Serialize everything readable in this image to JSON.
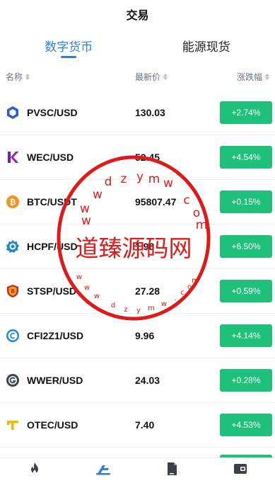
{
  "header": {
    "title": "交易"
  },
  "tabs": [
    {
      "label": "数字货币",
      "active": true
    },
    {
      "label": "能源现货",
      "active": false
    }
  ],
  "columns": {
    "name": "名称",
    "price": "最新价",
    "change": "涨跌幅"
  },
  "rows": [
    {
      "symbol": "PVSC/USD",
      "price": "130.03",
      "change": "+2.74%",
      "icon": "pvsc-hexagon-icon"
    },
    {
      "symbol": "WEC/USD",
      "price": "52.45",
      "change": "+4.54%",
      "icon": "wec-k-logo-icon"
    },
    {
      "symbol": "BTC/USDT",
      "price": "95807.47",
      "change": "+0.15%",
      "icon": "bitcoin-icon"
    },
    {
      "symbol": "HCPF/USD",
      "price": "1.98",
      "change": "+6.50%",
      "icon": "hcpf-badge-icon"
    },
    {
      "symbol": "STSP/USD",
      "price": "27.28",
      "change": "+0.59%",
      "icon": "stsp-shield-icon"
    },
    {
      "symbol": "CFI2Z1/USD",
      "price": "9.96",
      "change": "+4.14%",
      "icon": "cfi-coin-icon"
    },
    {
      "symbol": "WWER/USD",
      "price": "24.03",
      "change": "+0.28%",
      "icon": "wwer-gear-icon"
    },
    {
      "symbol": "OTEC/USD",
      "price": "7.40",
      "change": "+4.53%",
      "icon": "otec-t-logo-icon"
    }
  ],
  "watermark": {
    "text": "道臻源码网",
    "ring_text": "wwwdzymwcom"
  },
  "colors": {
    "accent": "#2f7fd8",
    "positive": "#1fc17a",
    "stamp": "#e01a1a"
  },
  "bottom_nav": [
    {
      "icon": "flame-icon",
      "active": false
    },
    {
      "icon": "trade-icon",
      "active": true
    },
    {
      "icon": "document-icon",
      "active": false
    },
    {
      "icon": "wallet-icon",
      "active": false
    }
  ]
}
